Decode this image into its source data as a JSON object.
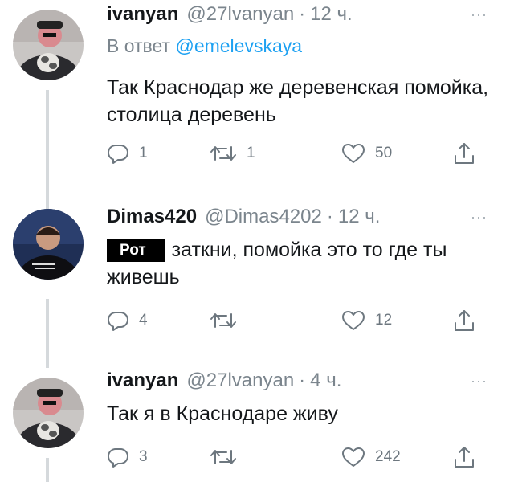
{
  "tweets": [
    {
      "name": "ivanyan",
      "handle": "@27lvanyan",
      "separator": "·",
      "time": "12 ч.",
      "more": "···",
      "reply_prefix": "В ответ",
      "reply_mention": "@emelevskaya",
      "text": "Так Краснодар же деревенская помойка, столица деревень",
      "replies": "1",
      "retweets": "1",
      "likes": "50"
    },
    {
      "name": "Dimas420",
      "handle": "@Dimas4202",
      "separator": "·",
      "time": "12 ч.",
      "more": "···",
      "redacted_label": "Рот",
      "text": "заткни, помойка это то где ты живешь",
      "replies": "4",
      "retweets": "",
      "likes": "12"
    },
    {
      "name": "ivanyan",
      "handle": "@27lvanyan",
      "separator": "·",
      "time": "4 ч.",
      "more": "···",
      "text": "Так я в Краснодаре живу",
      "replies": "3",
      "retweets": "",
      "likes": "242"
    }
  ],
  "colors": {
    "text": "#14171a",
    "secondary": "#7b858d",
    "mention": "#1da1f2",
    "thread_line": "#d5d9dc",
    "icon": "#6d777f"
  },
  "icons": [
    "reply-icon",
    "retweet-icon",
    "like-icon",
    "share-icon",
    "more-icon"
  ]
}
